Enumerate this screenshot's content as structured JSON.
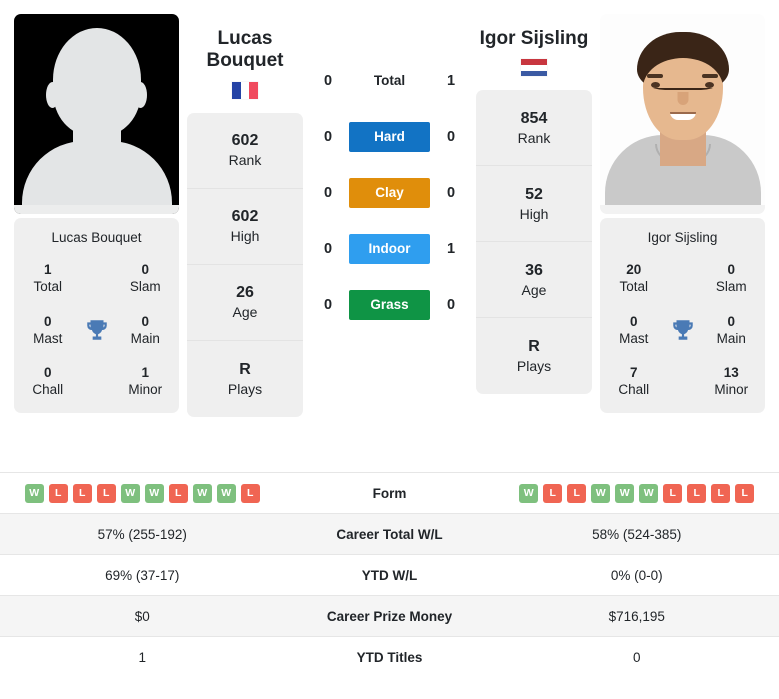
{
  "players": {
    "left": {
      "name": "Lucas Bouquet",
      "first_line": "Lucas",
      "second_line": "Bouquet",
      "country": "France",
      "flag": {
        "type": "vertical",
        "colors": [
          "#2543a5",
          "#ffffff",
          "#f04a5e"
        ]
      },
      "photo": "silhouette-placeholder",
      "stats": [
        {
          "value": "602",
          "label": "Rank"
        },
        {
          "value": "602",
          "label": "High"
        },
        {
          "value": "26",
          "label": "Age"
        },
        {
          "value": "R",
          "label": "Plays"
        }
      ],
      "titles": [
        {
          "value": "1",
          "label": "Total"
        },
        {
          "value": "0",
          "label": "Slam"
        },
        {
          "value": "0",
          "label": "Mast"
        },
        {
          "value": "0",
          "label": "Main"
        },
        {
          "value": "0",
          "label": "Chall"
        },
        {
          "value": "1",
          "label": "Minor"
        }
      ],
      "form": [
        "W",
        "L",
        "L",
        "L",
        "W",
        "W",
        "L",
        "W",
        "W",
        "L"
      ],
      "career_total_wl": "57% (255-192)",
      "ytd_wl": "69% (37-17)",
      "career_prize_money": "$0",
      "ytd_titles": "1"
    },
    "right": {
      "name": "Igor Sijsling",
      "first_line": "Igor Sijsling",
      "second_line": "",
      "country": "Netherlands",
      "flag": {
        "type": "horizontal",
        "colors": [
          "#c8363f",
          "#ffffff",
          "#3b5aa3"
        ]
      },
      "photo": "player-portrait",
      "stats": [
        {
          "value": "854",
          "label": "Rank"
        },
        {
          "value": "52",
          "label": "High"
        },
        {
          "value": "36",
          "label": "Age"
        },
        {
          "value": "R",
          "label": "Plays"
        }
      ],
      "titles": [
        {
          "value": "20",
          "label": "Total"
        },
        {
          "value": "0",
          "label": "Slam"
        },
        {
          "value": "0",
          "label": "Mast"
        },
        {
          "value": "0",
          "label": "Main"
        },
        {
          "value": "7",
          "label": "Chall"
        },
        {
          "value": "13",
          "label": "Minor"
        }
      ],
      "form": [
        "W",
        "L",
        "L",
        "W",
        "W",
        "W",
        "L",
        "L",
        "L",
        "L"
      ],
      "career_total_wl": "58% (524-385)",
      "ytd_wl": "0% (0-0)",
      "career_prize_money": "$716,195",
      "ytd_titles": "0"
    }
  },
  "head_to_head": [
    {
      "label": "Total",
      "left": "0",
      "right": "1",
      "style": "plain",
      "color": ""
    },
    {
      "label": "Hard",
      "left": "0",
      "right": "0",
      "style": "badge",
      "color": "#1273c4"
    },
    {
      "label": "Clay",
      "left": "0",
      "right": "0",
      "style": "badge",
      "color": "#e08e0b"
    },
    {
      "label": "Indoor",
      "left": "0",
      "right": "1",
      "style": "badge",
      "color": "#2f9eef"
    },
    {
      "label": "Grass",
      "left": "0",
      "right": "0",
      "style": "badge",
      "color": "#0f9445"
    }
  ],
  "table_rows": [
    {
      "label": "Form",
      "type": "form",
      "left": "",
      "right": "",
      "shaded": false
    },
    {
      "label": "Career Total W/L",
      "type": "text",
      "left": "57% (255-192)",
      "right": "58% (524-385)",
      "shaded": true
    },
    {
      "label": "YTD W/L",
      "type": "text",
      "left": "69% (37-17)",
      "right": "0% (0-0)",
      "shaded": false
    },
    {
      "label": "Career Prize Money",
      "type": "text",
      "left": "$0",
      "right": "$716,195",
      "shaded": true
    },
    {
      "label": "YTD Titles",
      "type": "text",
      "left": "1",
      "right": "0",
      "shaded": false
    }
  ],
  "colors": {
    "win_badge": "#7ec07e",
    "loss_badge": "#f06553",
    "card_bg": "#efefef",
    "trophy": "#4a7ab5",
    "row_shade": "#f5f5f5"
  }
}
